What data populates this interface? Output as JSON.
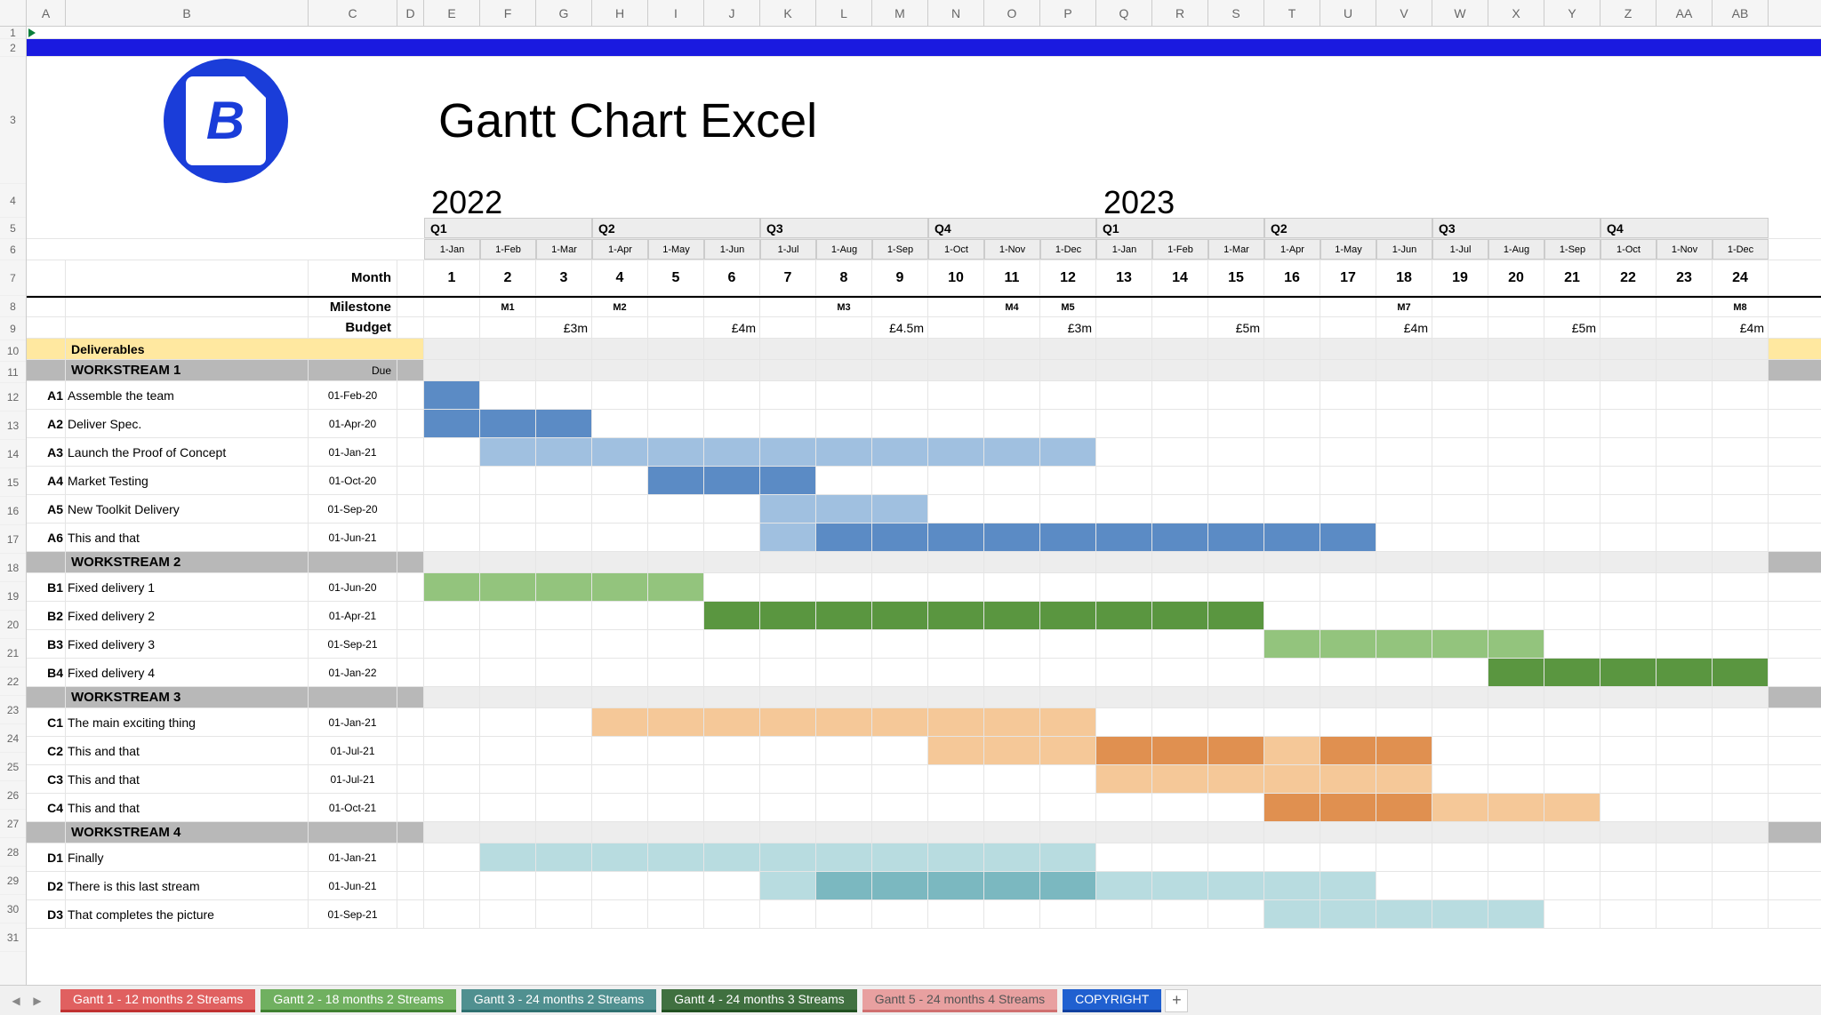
{
  "col_letters": [
    "A",
    "B",
    "C",
    "D",
    "E",
    "F",
    "G",
    "H",
    "I",
    "J",
    "K",
    "L",
    "M",
    "N",
    "O",
    "P",
    "Q",
    "R",
    "S",
    "T",
    "U",
    "V",
    "W",
    "X",
    "Y",
    "Z",
    "AA",
    "AB"
  ],
  "row_numbers": [
    "1",
    "2",
    "3",
    "4",
    "5",
    "6",
    "7",
    "8",
    "9",
    "10",
    "11",
    "12",
    "13",
    "14",
    "15",
    "16",
    "17",
    "18",
    "19",
    "20",
    "21",
    "22",
    "23",
    "24",
    "25",
    "26",
    "27",
    "28",
    "29",
    "30",
    "31"
  ],
  "title": "Gantt Chart Excel",
  "logo_letter": "B",
  "years": {
    "y2022": "2022",
    "y2023": "2023"
  },
  "quarters": [
    "Q1",
    "Q2",
    "Q3",
    "Q4",
    "Q1",
    "Q2",
    "Q3",
    "Q4"
  ],
  "month_abbrs": [
    "1-Jan",
    "1-Feb",
    "1-Mar",
    "1-Apr",
    "1-May",
    "1-Jun",
    "1-Jul",
    "1-Aug",
    "1-Sep",
    "1-Oct",
    "1-Nov",
    "1-Dec",
    "1-Jan",
    "1-Feb",
    "1-Mar",
    "1-Apr",
    "1-May",
    "1-Jun",
    "1-Jul",
    "1-Aug",
    "1-Sep",
    "1-Oct",
    "1-Nov",
    "1-Dec"
  ],
  "month_nums": [
    "1",
    "2",
    "3",
    "4",
    "5",
    "6",
    "7",
    "8",
    "9",
    "10",
    "11",
    "12",
    "13",
    "14",
    "15",
    "16",
    "17",
    "18",
    "19",
    "20",
    "21",
    "22",
    "23",
    "24"
  ],
  "labels": {
    "month": "Month",
    "milestone": "Milestone",
    "budget": "Budget",
    "deliverables": "Deliverables",
    "due": "Due"
  },
  "milestones": {
    "2": "M1",
    "4": "M2",
    "8": "M3",
    "11": "M4",
    "12": "M5",
    "15": "",
    "18": "M7",
    "24": "M8"
  },
  "budgets": {
    "3": "£3m",
    "6": "£4m",
    "9": "£4.5m",
    "12": "£3m",
    "15": "£5m",
    "18": "£4m",
    "21": "£5m",
    "24": "£4m"
  },
  "workstreams": [
    {
      "name": "WORKSTREAM 1",
      "color": "blue",
      "tasks": [
        {
          "id": "A1",
          "name": "Assemble the team",
          "due": "01-Feb-20",
          "start": 1,
          "end": 1,
          "shade": "dark"
        },
        {
          "id": "A2",
          "name": "Deliver Spec.",
          "due": "01-Apr-20",
          "start": 1,
          "end": 3,
          "shade": "dark"
        },
        {
          "id": "A3",
          "name": "Launch the Proof of Concept",
          "due": "01-Jan-21",
          "start": 2,
          "end": 12,
          "shade": "light"
        },
        {
          "id": "A4",
          "name": "Market Testing",
          "due": "01-Oct-20",
          "start": 5,
          "end": 7,
          "shade": "dark"
        },
        {
          "id": "A5",
          "name": "New Toolkit Delivery",
          "due": "01-Sep-20",
          "start": 7,
          "end": 9,
          "shade": "light"
        },
        {
          "id": "A6",
          "name": "This and that",
          "due": "01-Jun-21",
          "start": 7,
          "end": 17,
          "shade": "dark",
          "light_first": true
        }
      ]
    },
    {
      "name": "WORKSTREAM 2",
      "color": "green",
      "tasks": [
        {
          "id": "B1",
          "name": "Fixed delivery 1",
          "due": "01-Jun-20",
          "start": 1,
          "end": 5,
          "shade": "light"
        },
        {
          "id": "B2",
          "name": "Fixed delivery 2",
          "due": "01-Apr-21",
          "start": 6,
          "end": 15,
          "shade": "dark"
        },
        {
          "id": "B3",
          "name": "Fixed delivery 3",
          "due": "01-Sep-21",
          "start": 16,
          "end": 20,
          "shade": "light"
        },
        {
          "id": "B4",
          "name": "Fixed delivery 4",
          "due": "01-Jan-22",
          "start": 20,
          "end": 24,
          "shade": "dark"
        }
      ]
    },
    {
      "name": "WORKSTREAM 3",
      "color": "orange",
      "tasks": [
        {
          "id": "C1",
          "name": "The main exciting thing",
          "due": "01-Jan-21",
          "start": 4,
          "end": 12,
          "shade": "light"
        },
        {
          "id": "C2",
          "name": "This and that",
          "due": "01-Jul-21",
          "start": 10,
          "end": 18,
          "shade": "light",
          "dark_segments": [
            [
              13,
              15
            ],
            [
              17,
              18
            ]
          ]
        },
        {
          "id": "C3",
          "name": "This and that",
          "due": "01-Jul-21",
          "start": 13,
          "end": 18,
          "shade": "light"
        },
        {
          "id": "C4",
          "name": "This and that",
          "due": "01-Oct-21",
          "start": 16,
          "end": 21,
          "shade": "dark",
          "light_segments": [
            [
              19,
              21
            ]
          ]
        }
      ]
    },
    {
      "name": "WORKSTREAM 4",
      "color": "teal",
      "tasks": [
        {
          "id": "D1",
          "name": "Finally",
          "due": "01-Jan-21",
          "start": 2,
          "end": 12,
          "shade": "light"
        },
        {
          "id": "D2",
          "name": "There is this last stream",
          "due": "01-Jun-21",
          "start": 7,
          "end": 17,
          "shade": "dark",
          "light_first": true,
          "light_segments": [
            [
              13,
              17
            ]
          ]
        },
        {
          "id": "D3",
          "name": "That completes the picture",
          "due": "01-Sep-21",
          "start": 16,
          "end": 20,
          "shade": "light"
        }
      ]
    }
  ],
  "tabs": [
    {
      "label": "Gantt 1 - 12 months  2 Streams",
      "class": "tab-red"
    },
    {
      "label": "Gantt 2 - 18 months 2 Streams",
      "class": "tab-green"
    },
    {
      "label": "Gantt 3 - 24 months 2 Streams",
      "class": "tab-teal"
    },
    {
      "label": "Gantt 4 - 24 months 3 Streams",
      "class": "tab-dgreen"
    },
    {
      "label": "Gantt 5 - 24 months 4 Streams",
      "class": "tab-pink"
    },
    {
      "label": "COPYRIGHT",
      "class": "tab-blue"
    }
  ],
  "chart_data": {
    "type": "bar",
    "title": "Gantt Chart Excel",
    "xlabel": "Month",
    "x": [
      "2022-01",
      "2022-02",
      "2022-03",
      "2022-04",
      "2022-05",
      "2022-06",
      "2022-07",
      "2022-08",
      "2022-09",
      "2022-10",
      "2022-11",
      "2022-12",
      "2023-01",
      "2023-02",
      "2023-03",
      "2023-04",
      "2023-05",
      "2023-06",
      "2023-07",
      "2023-08",
      "2023-09",
      "2023-10",
      "2023-11",
      "2023-12"
    ],
    "milestones": [
      {
        "month": 2,
        "label": "M1"
      },
      {
        "month": 4,
        "label": "M2"
      },
      {
        "month": 8,
        "label": "M3"
      },
      {
        "month": 11,
        "label": "M4"
      },
      {
        "month": 12,
        "label": "M5"
      },
      {
        "month": 18,
        "label": "M7"
      },
      {
        "month": 24,
        "label": "M8"
      }
    ],
    "budgets": [
      {
        "month": 3,
        "value": "£3m"
      },
      {
        "month": 6,
        "value": "£4m"
      },
      {
        "month": 9,
        "value": "£4.5m"
      },
      {
        "month": 12,
        "value": "£3m"
      },
      {
        "month": 15,
        "value": "£5m"
      },
      {
        "month": 18,
        "value": "£4m"
      },
      {
        "month": 21,
        "value": "£5m"
      },
      {
        "month": 24,
        "value": "£4m"
      }
    ],
    "series": [
      {
        "group": "WORKSTREAM 1",
        "name": "A1 Assemble the team",
        "start": 1,
        "end": 1
      },
      {
        "group": "WORKSTREAM 1",
        "name": "A2 Deliver Spec.",
        "start": 1,
        "end": 3
      },
      {
        "group": "WORKSTREAM 1",
        "name": "A3 Launch the Proof of Concept",
        "start": 2,
        "end": 12
      },
      {
        "group": "WORKSTREAM 1",
        "name": "A4 Market Testing",
        "start": 5,
        "end": 7
      },
      {
        "group": "WORKSTREAM 1",
        "name": "A5 New Toolkit Delivery",
        "start": 7,
        "end": 9
      },
      {
        "group": "WORKSTREAM 1",
        "name": "A6 This and that",
        "start": 7,
        "end": 17
      },
      {
        "group": "WORKSTREAM 2",
        "name": "B1 Fixed delivery 1",
        "start": 1,
        "end": 5
      },
      {
        "group": "WORKSTREAM 2",
        "name": "B2 Fixed delivery 2",
        "start": 6,
        "end": 15
      },
      {
        "group": "WORKSTREAM 2",
        "name": "B3 Fixed delivery 3",
        "start": 16,
        "end": 20
      },
      {
        "group": "WORKSTREAM 2",
        "name": "B4 Fixed delivery 4",
        "start": 20,
        "end": 24
      },
      {
        "group": "WORKSTREAM 3",
        "name": "C1 The main exciting thing",
        "start": 4,
        "end": 12
      },
      {
        "group": "WORKSTREAM 3",
        "name": "C2 This and that",
        "start": 10,
        "end": 18
      },
      {
        "group": "WORKSTREAM 3",
        "name": "C3 This and that",
        "start": 13,
        "end": 18
      },
      {
        "group": "WORKSTREAM 3",
        "name": "C4 This and that",
        "start": 16,
        "end": 21
      },
      {
        "group": "WORKSTREAM 4",
        "name": "D1 Finally",
        "start": 2,
        "end": 12
      },
      {
        "group": "WORKSTREAM 4",
        "name": "D2 There is this last stream",
        "start": 7,
        "end": 17
      },
      {
        "group": "WORKSTREAM 4",
        "name": "D3 That completes the picture",
        "start": 16,
        "end": 20
      }
    ]
  }
}
